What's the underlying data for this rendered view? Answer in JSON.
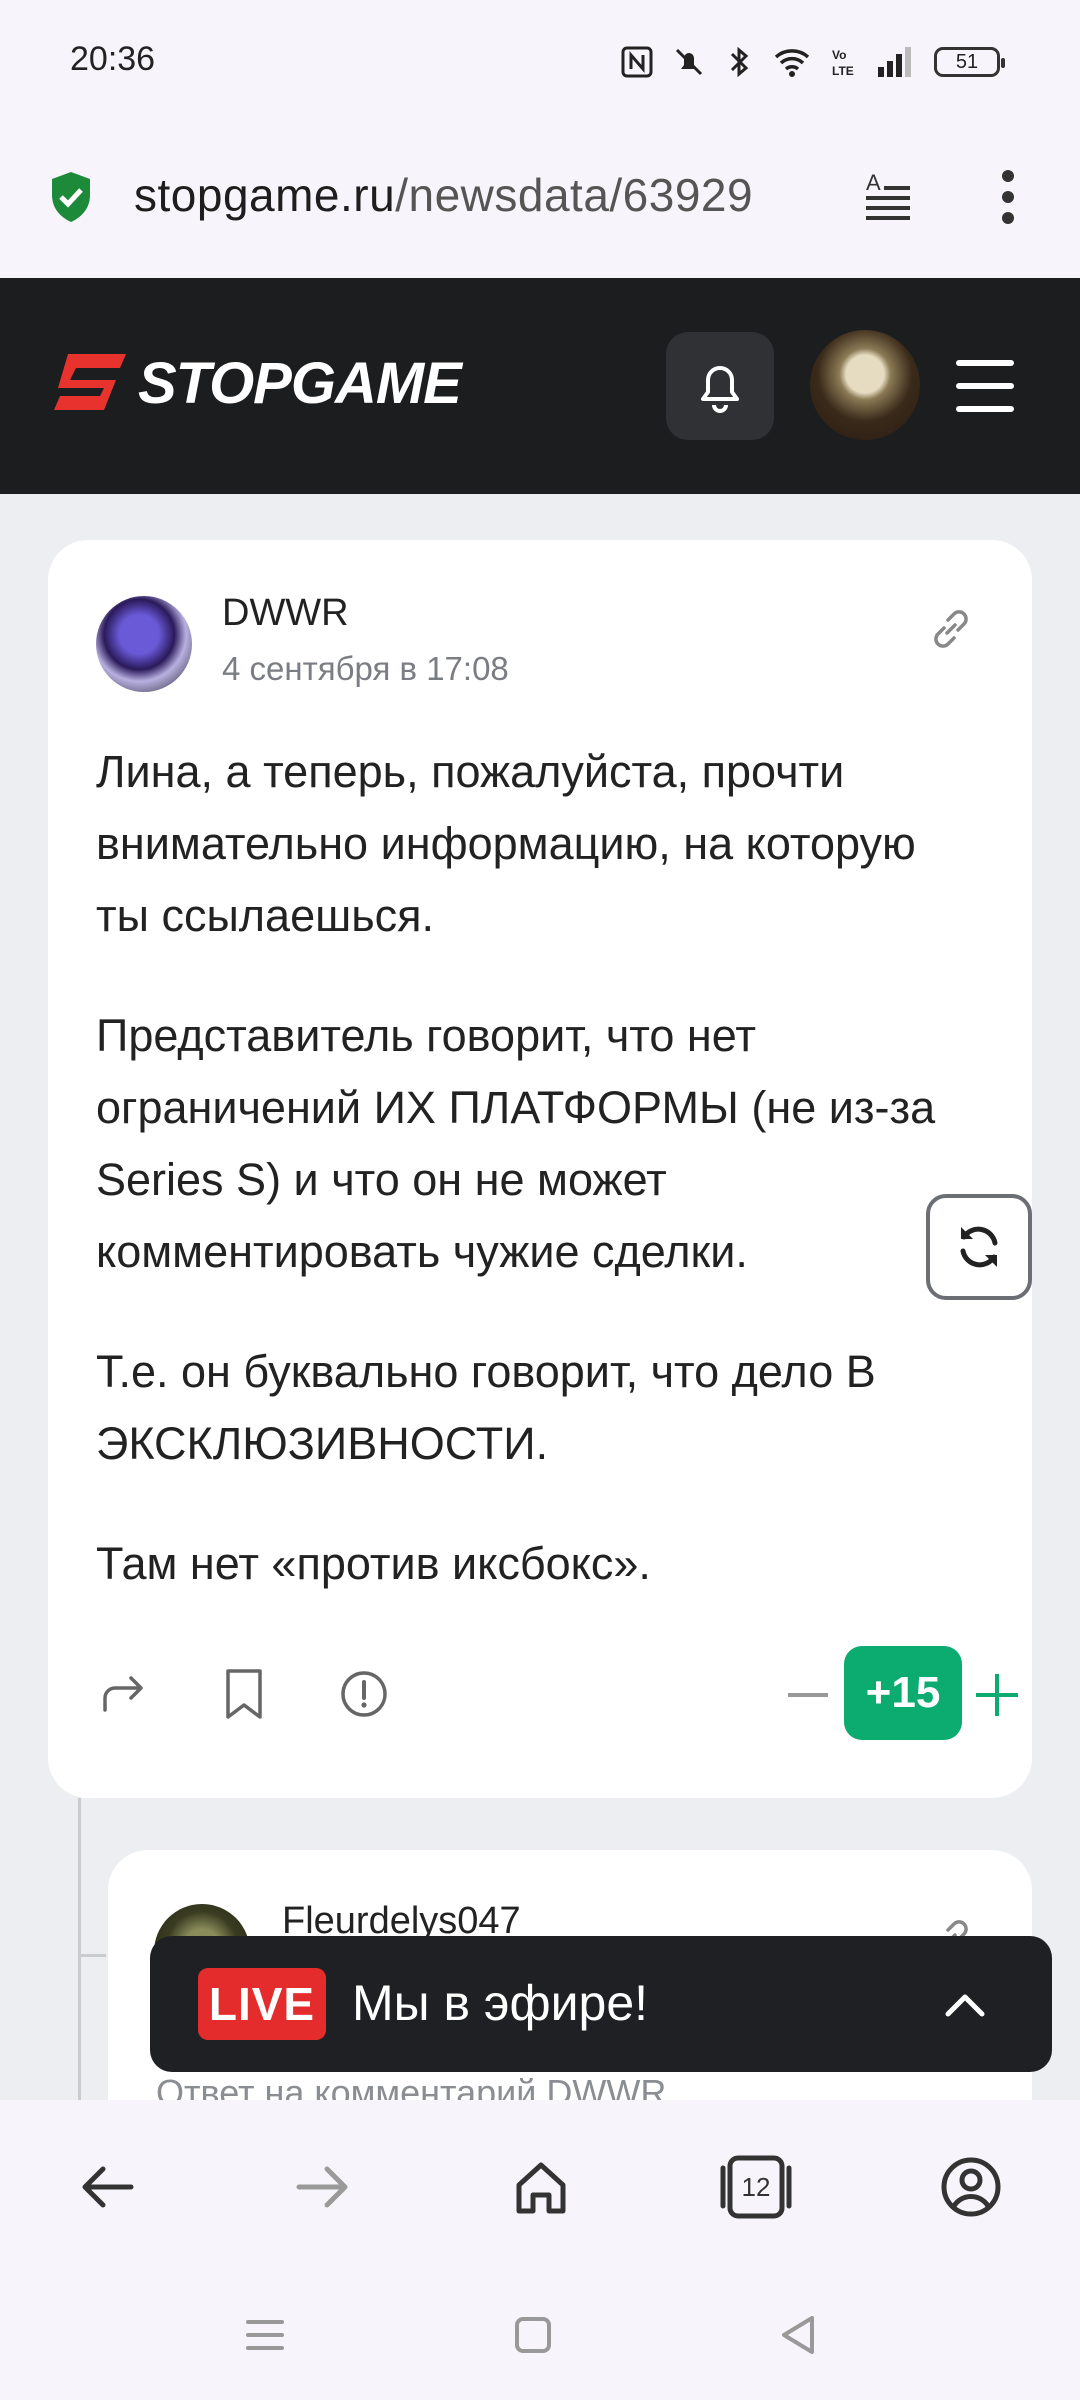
{
  "status_bar": {
    "time": "20:36",
    "battery": "51"
  },
  "address_bar": {
    "url_host": "stopgame.ru",
    "url_path": "/newsdata/63929"
  },
  "header": {
    "logo": "STOPGAME"
  },
  "comment": {
    "author": "DWWR",
    "date": "4 сентября в 17:08",
    "paragraphs": [
      "Лина, а теперь, пожалуйста, прочти внимательно информацию, на которую ты ссылаешься.",
      "Представитель говорит, что нет ограничений ИХ ПЛАТФОРМЫ (не из-за Series S) и что он не может комментировать чужие сделки.",
      "Т.е. он буквально говорит, что дело В ЭКСКЛЮЗИВНОСТИ.",
      "Там нет «против иксбокс»."
    ],
    "score": "+15"
  },
  "reply": {
    "author": "Fleurdelys047",
    "reply_to": "Ответ на комментарий DWWR"
  },
  "live": {
    "badge": "LIVE",
    "text": "Мы в эфире!"
  },
  "browser_nav": {
    "tabs_count": "12"
  },
  "colors": {
    "accent_green": "#0cab70",
    "header_bg": "#1c1d1f",
    "live_red": "#e32c2b"
  }
}
